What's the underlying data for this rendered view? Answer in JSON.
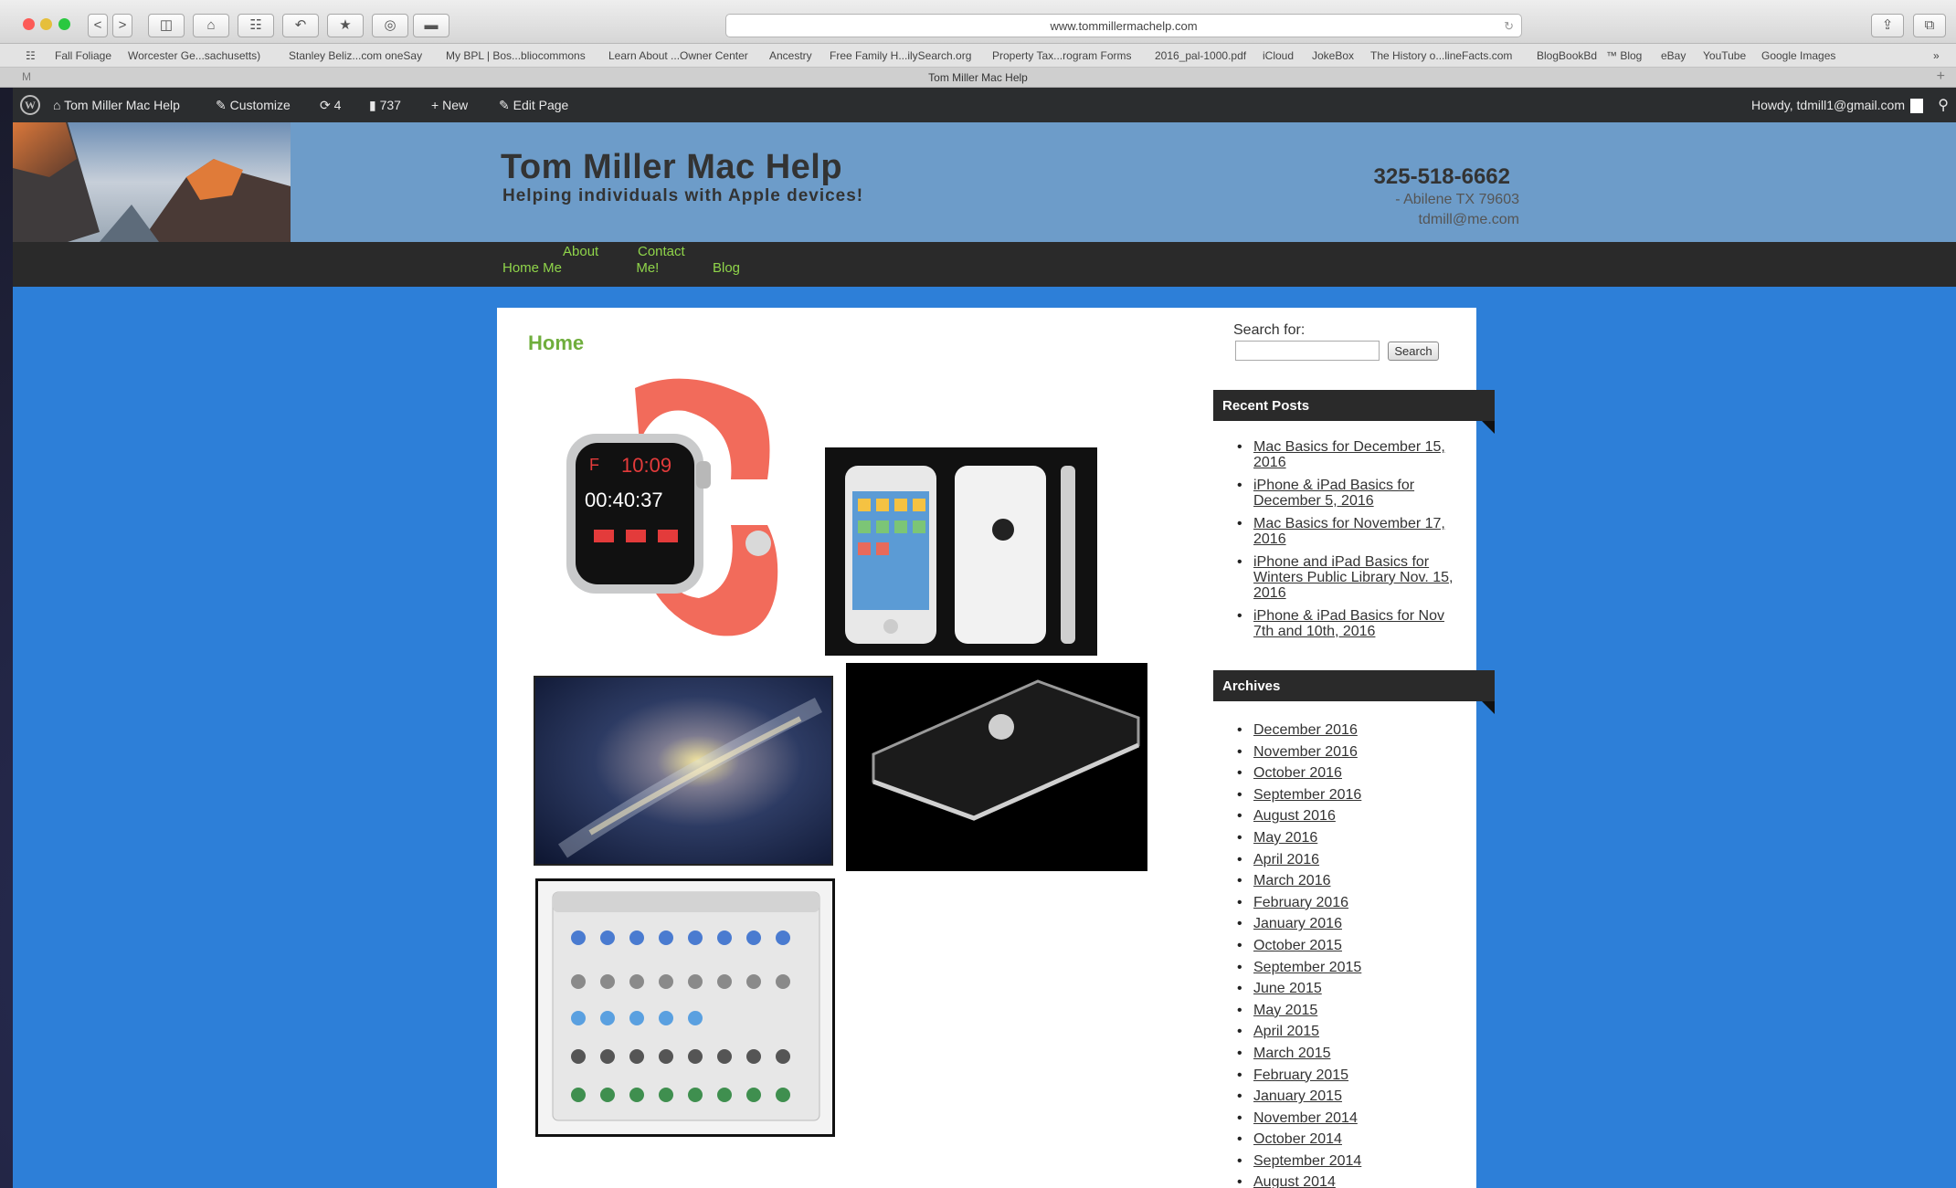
{
  "browser": {
    "url": "www.tommillermachelp.com",
    "tab_title": "Tom Miller Mac Help",
    "mail_label": "M",
    "buttons": [
      "<",
      ">",
      "◫",
      "⌂",
      "☷",
      "↶",
      "★",
      "◎",
      "▬"
    ],
    "right_buttons": [
      "⇪",
      "⧉"
    ],
    "bookmarks": [
      "Fall Foliage",
      "Worcester Ge...sachusetts)",
      "Stanley Beliz...com oneSay",
      "My BPL | Bos...bliocommons",
      "Learn About ...Owner Center",
      "Ancestry",
      "Free Family H...ilySearch.org",
      "Property Tax...rogram Forms",
      "2016_pal-1000.pdf",
      "iCloud",
      "JokeBox",
      "The History o...lineFacts.com",
      "BlogBookBd",
      "™ Blog",
      "eBay",
      "YouTube",
      "Google Images"
    ],
    "bookmarks_more": "»"
  },
  "adminbar": {
    "site": "Tom Miller Mac Help",
    "customize": "Customize",
    "updates_count": "4",
    "comments_count": "737",
    "new": "New",
    "edit_page": "Edit Page",
    "howdy": "Howdy, tdmill1@gmail.com"
  },
  "header": {
    "title": "Tom Miller Mac Help",
    "tagline": "Helping individuals with Apple devices!",
    "phone": "325-518-6662",
    "address": "- Abilene TX 79603",
    "email": "tdmill@me.com"
  },
  "nav": {
    "home_line1": "",
    "home_line2": "Home Me",
    "about_line1": "About",
    "contact_line1": "Contact",
    "contact_line2": "Me!",
    "blog": "Blog"
  },
  "main": {
    "page_title": "Home",
    "watch_time": "10:09",
    "watch_timer": "00:40:37"
  },
  "sidebar": {
    "search_label": "Search for:",
    "search_value": "",
    "search_button": "Search",
    "recent_title": "Recent Posts",
    "recent_posts": [
      "Mac Basics for December 15, 2016",
      "iPhone & iPad Basics for December 5, 2016",
      "Mac Basics for November 17, 2016",
      "iPhone and iPad Basics for Winters Public Library Nov. 15, 2016",
      "iPhone & iPad Basics for Nov 7th and 10th, 2016"
    ],
    "archives_title": "Archives",
    "archives": [
      "December 2016",
      "November 2016",
      "October 2016",
      "September 2016",
      "August 2016",
      "May 2016",
      "April 2016",
      "March 2016",
      "February 2016",
      "January 2016",
      "October 2015",
      "September 2015",
      "June 2015",
      "May 2015",
      "April 2015",
      "March 2015",
      "February 2015",
      "January 2015",
      "November 2014",
      "October 2014",
      "September 2014",
      "August 2014"
    ]
  },
  "colors": {
    "page_bg": "#2d7fd8",
    "header_bg": "#6d9cc9",
    "nav_bg": "#2a2a2a",
    "nav_link": "#8fd44a",
    "home_title": "#6fae3c"
  }
}
